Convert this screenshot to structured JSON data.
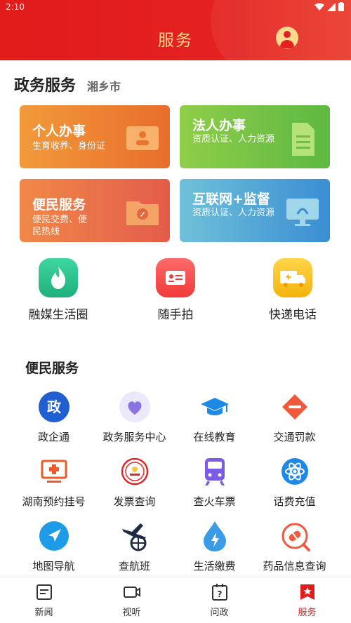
{
  "status_bar": {
    "time": "2:10"
  },
  "header": {
    "title": "服务"
  },
  "gov": {
    "title": "政务服务",
    "city": "湘乡市",
    "cards": [
      {
        "title": "个人办事",
        "subtitle": "生育收养、身份证"
      },
      {
        "title": "法人办事",
        "subtitle": "资质认证、人力资源"
      },
      {
        "title": "便民服务",
        "subtitle": "便民交费、便民热线"
      },
      {
        "title": "互联网+监督",
        "subtitle": "资质认证、人力资源"
      }
    ]
  },
  "quick_links": [
    {
      "label": "融媒生活圈",
      "icon": "flame-icon"
    },
    {
      "label": "随手拍",
      "icon": "camera-card-icon"
    },
    {
      "label": "快递电话",
      "icon": "delivery-truck-icon"
    }
  ],
  "convenience": {
    "title": "便民服务",
    "items": [
      {
        "label": "政企通",
        "icon": "gov-badge-icon"
      },
      {
        "label": "政务服务中心",
        "icon": "heart-chat-icon"
      },
      {
        "label": "在线教育",
        "icon": "graduation-cap-icon"
      },
      {
        "label": "交通罚款",
        "icon": "no-entry-icon"
      },
      {
        "label": "湖南预约挂号",
        "icon": "hospital-monitor-icon"
      },
      {
        "label": "发票查询",
        "icon": "tax-seal-icon"
      },
      {
        "label": "查火车票",
        "icon": "train-icon"
      },
      {
        "label": "话费充值",
        "icon": "atom-icon"
      },
      {
        "label": "地图导航",
        "icon": "navigation-icon"
      },
      {
        "label": "查航班",
        "icon": "airplane-globe-icon"
      },
      {
        "label": "生活缴费",
        "icon": "water-drop-icon"
      },
      {
        "label": "药品信息查询",
        "icon": "pill-search-icon"
      }
    ]
  },
  "bottom_nav": [
    {
      "label": "新闻",
      "icon": "news-icon",
      "active": false
    },
    {
      "label": "视听",
      "icon": "video-icon",
      "active": false
    },
    {
      "label": "问政",
      "icon": "question-calendar-icon",
      "active": false
    },
    {
      "label": "服务",
      "icon": "star-flag-icon",
      "active": true
    }
  ],
  "colors": {
    "brand_red": "#e21b1b",
    "header_text": "#ffd98c"
  }
}
